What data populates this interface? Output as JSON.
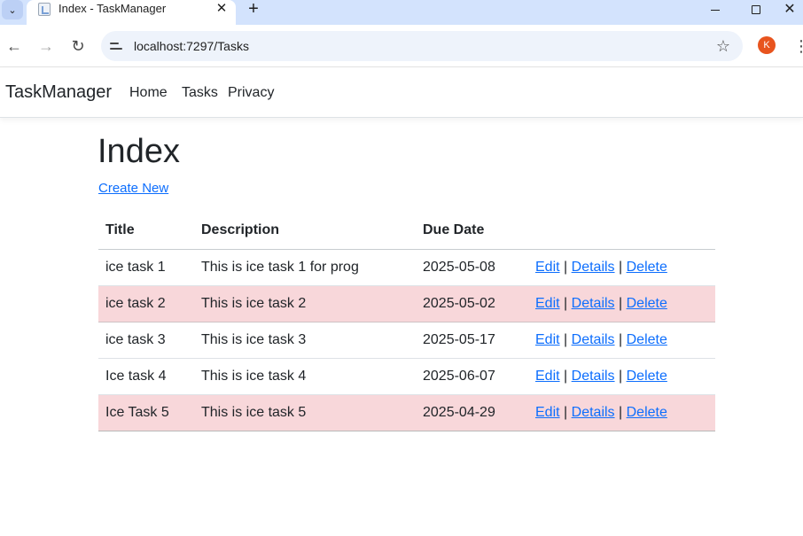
{
  "browser": {
    "tab_title": "Index - TaskManager",
    "url": "localhost:7297/Tasks",
    "profile_initial": "K",
    "icons": {
      "back": "arrow-left",
      "forward": "arrow-right",
      "reload": "reload",
      "bookmark": "star",
      "menu": "kebab"
    }
  },
  "nav": {
    "brand": "TaskManager",
    "links": [
      "Home",
      "Tasks",
      "Privacy"
    ]
  },
  "page": {
    "heading": "Index",
    "create_link": "Create New"
  },
  "table": {
    "headers": [
      "Title",
      "Description",
      "Due Date",
      ""
    ],
    "rows": [
      {
        "title": "ice task 1",
        "description": "This is ice task 1 for prog",
        "due": "2025-05-08",
        "highlighted": false
      },
      {
        "title": "ice task 2",
        "description": "This is ice task 2",
        "due": "2025-05-02",
        "highlighted": true
      },
      {
        "title": "ice task 3",
        "description": "This is ice task 3",
        "due": "2025-05-17",
        "highlighted": false
      },
      {
        "title": "Ice task 4",
        "description": "This is ice task 4",
        "due": "2025-06-07",
        "highlighted": false
      },
      {
        "title": "Ice Task 5",
        "description": "This is ice task 5",
        "due": "2025-04-29",
        "highlighted": true
      }
    ],
    "actions": {
      "edit": "Edit",
      "details": "Details",
      "delete": "Delete",
      "separator": "|"
    }
  },
  "colors": {
    "tabstrip": "#d3e3fd",
    "link": "#0d6efd",
    "highlight_row": "#f8d7da",
    "avatar": "#e8541e"
  }
}
